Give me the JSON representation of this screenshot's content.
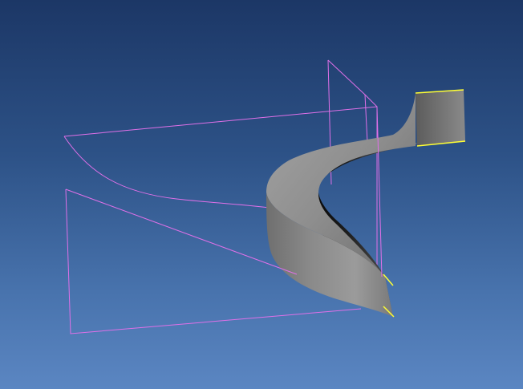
{
  "viewer": {
    "background_top": "#1c3766",
    "background_bottom": "#5b86c2"
  },
  "colors": {
    "construction_plane": "#e070e8",
    "profile_curve": "#e070e8",
    "surface_edge_highlight": "#ffff33",
    "surface_light": "#a9a9a9",
    "surface_mid": "#7c7c7c",
    "surface_dark": "#1a1a1a"
  },
  "scene_objects": [
    "construction-plane-horizontal",
    "construction-plane-vertical",
    "profile-curve",
    "guide-curve",
    "swept-surface"
  ]
}
